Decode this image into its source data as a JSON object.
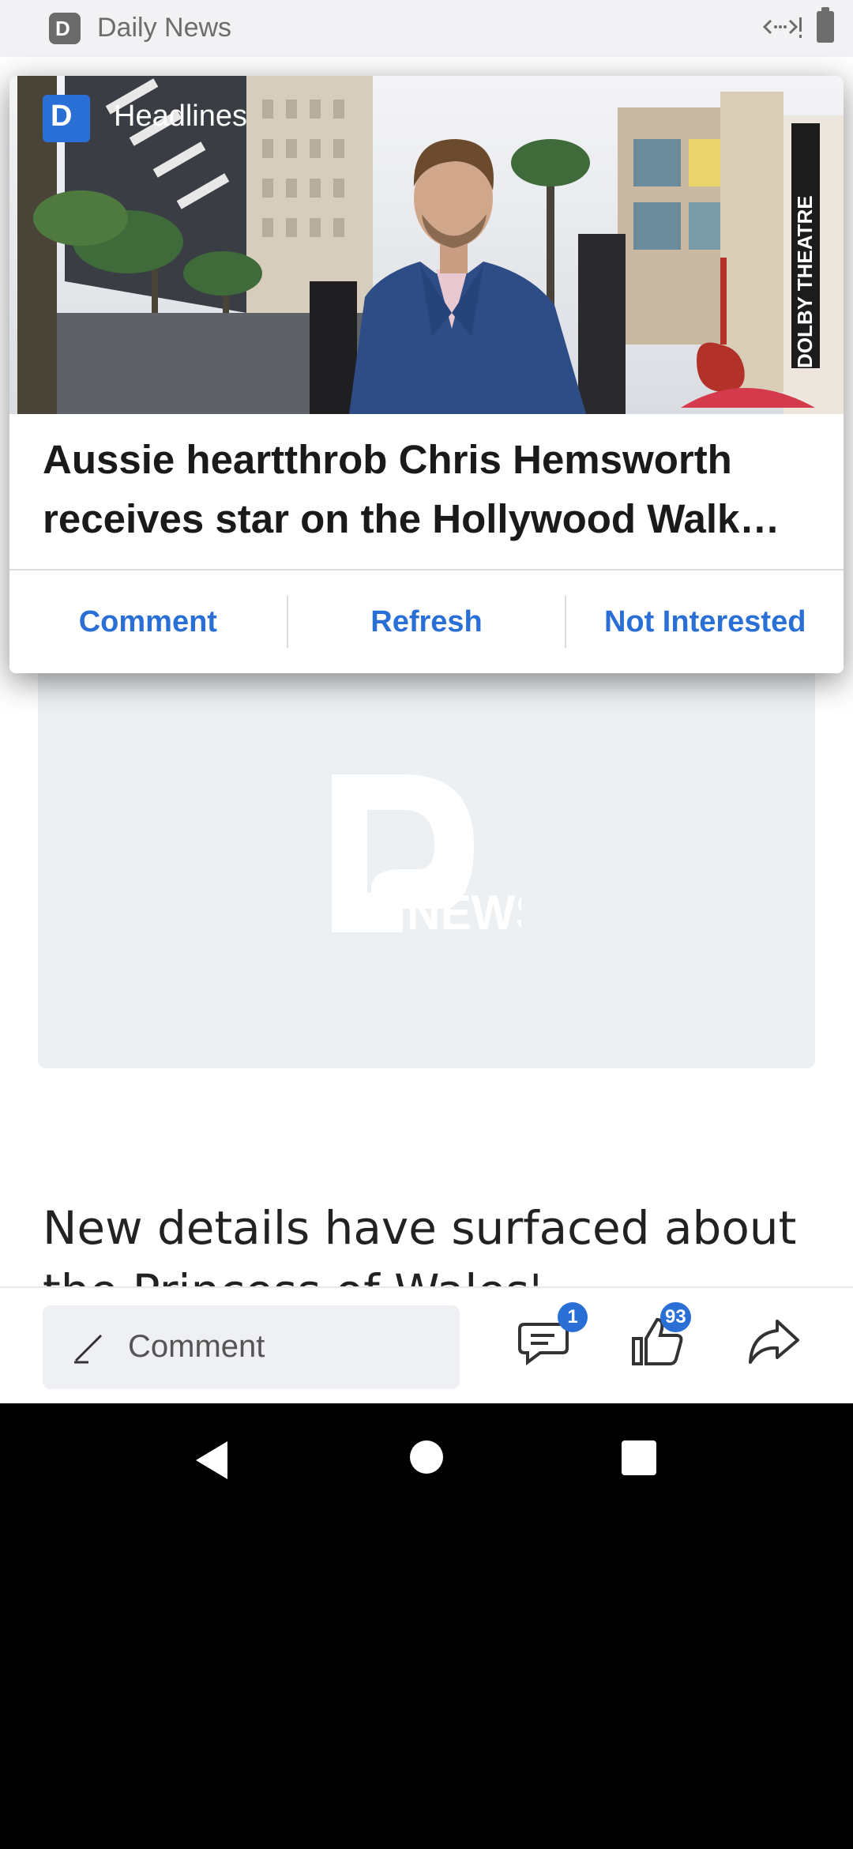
{
  "status_bar": {
    "app_title": "Daily News"
  },
  "popup": {
    "label": "Headlines",
    "headline": "Aussie heartthrob Chris Hemsworth receives star on the Hollywood Walk…",
    "photo_sign_text": "DOLBY THEATRE",
    "actions": {
      "comment": "Comment",
      "refresh": "Refresh",
      "not_interested": "Not Interested"
    }
  },
  "article": {
    "logo_text": "NEWS",
    "paragraph_line1": "New details have surfaced about",
    "paragraph_line2": "the Princess of Wales'"
  },
  "toolbar": {
    "comment_placeholder": "Comment",
    "comment_count": "1",
    "like_count": "93"
  },
  "colors": {
    "accent": "#2a6fd6",
    "placeholder_bg": "#edf0f3"
  }
}
